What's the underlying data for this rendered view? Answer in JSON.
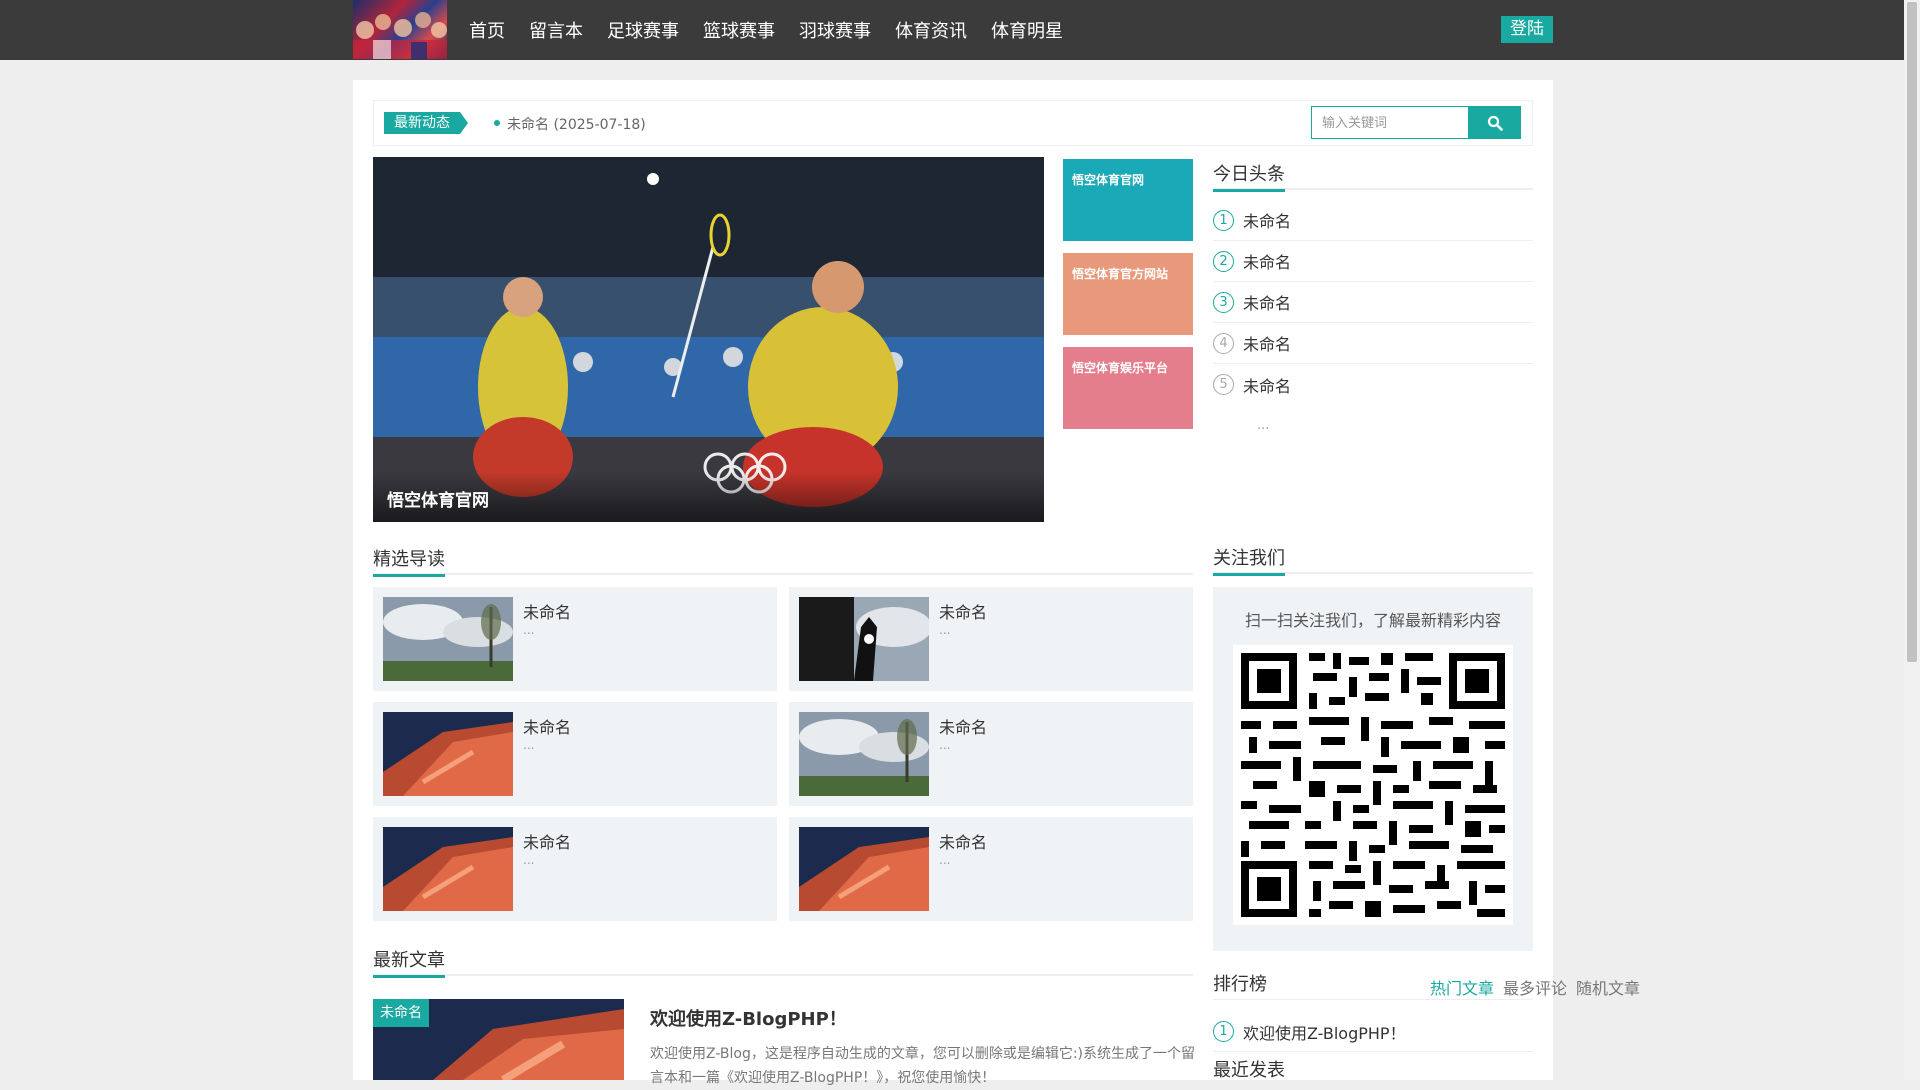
{
  "header": {
    "nav": [
      "首页",
      "留言本",
      "足球赛事",
      "篮球赛事",
      "羽球赛事",
      "体育资讯",
      "体育明星"
    ],
    "login_label": "登陆"
  },
  "ticker": {
    "tag": "最新动态",
    "item": "未命名 (2025-07-18)"
  },
  "search": {
    "placeholder": "输入关键词",
    "button_icon": "search-icon"
  },
  "slider": {
    "caption": "悟空体育官网"
  },
  "tiles": [
    {
      "label": "悟空体育官网",
      "color": "#1aa9b7"
    },
    {
      "label": "悟空体育官方网站",
      "color": "#e8997b"
    },
    {
      "label": "悟空体育娱乐平台",
      "color": "#e47e8c"
    }
  ],
  "headlines": {
    "title": "今日头条",
    "items": [
      "未命名",
      "未命名",
      "未命名",
      "未命名",
      "未命名"
    ],
    "numbers": [
      "1",
      "2",
      "3",
      "4",
      "5"
    ],
    "more": "..."
  },
  "featured": {
    "title": "精选导读",
    "items": [
      {
        "title": "未命名",
        "desc": "..."
      },
      {
        "title": "未命名",
        "desc": "..."
      },
      {
        "title": "未命名",
        "desc": "..."
      },
      {
        "title": "未命名",
        "desc": "..."
      },
      {
        "title": "未命名",
        "desc": "..."
      },
      {
        "title": "未命名",
        "desc": "..."
      }
    ]
  },
  "follow": {
    "title": "关注我们",
    "text": "扫一扫关注我们，了解最新精彩内容"
  },
  "ranking": {
    "title": "排行榜",
    "tabs": [
      "热门文章",
      "最多评论",
      "随机文章"
    ],
    "items": [
      {
        "num": "1",
        "text": "欢迎使用Z-BlogPHP！"
      }
    ]
  },
  "latest": {
    "title": "最新文章",
    "badge": "未命名",
    "article_title": "欢迎使用Z-BlogPHP！",
    "article_desc": "欢迎使用Z-Blog，这是程序自动生成的文章，您可以删除或是编辑它:)系统生成了一个留言本和一篇《欢迎使用Z-BlogPHP！》，祝您使用愉快！"
  },
  "recent": {
    "title": "最近发表"
  },
  "colors": {
    "accent": "#1aa9a0",
    "header_bg": "#3b3b3b"
  }
}
